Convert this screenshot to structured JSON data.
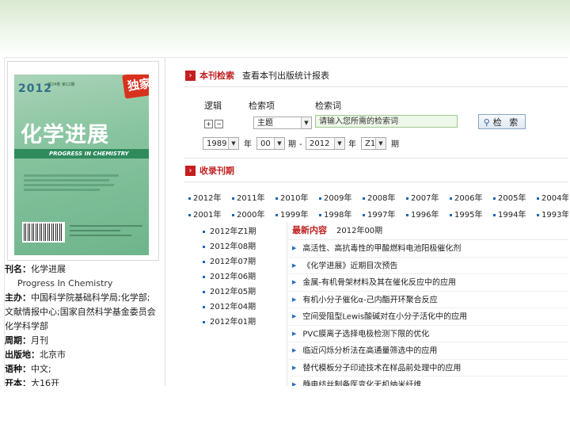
{
  "cover": {
    "year": "2012",
    "issue_text": "第24卷 第12期",
    "badge": "独家",
    "title": "化学进展",
    "title_en": "PROGRESS IN CHEMISTRY"
  },
  "journal_info": [
    {
      "label": "刊名：",
      "value": "化学进展"
    },
    {
      "label": "",
      "value": "Progress In Chemistry",
      "en": true
    },
    {
      "label": "主办：",
      "value": "中国科学院基础科学局;化学部;"
    },
    {
      "label": "",
      "value": "文献情报中心;国家自然科学基金委员会"
    },
    {
      "label": "",
      "value": "化学科学部"
    },
    {
      "label": "周期：",
      "value": "月刊"
    },
    {
      "label": "出版地：",
      "value": "北京市"
    },
    {
      "label": "语种：",
      "value": "中文;"
    },
    {
      "label": "开本：",
      "value": "大16开"
    }
  ],
  "search_section": {
    "title": "本刊检索",
    "link": "查看本刊出版统计报表",
    "col_logic": "逻辑",
    "col_field": "检索项",
    "col_keyword": "检索词",
    "logic_plus": "+",
    "logic_minus": "−",
    "field_value": "主题",
    "keyword_placeholder": "请输入您所需的检索词",
    "search_button": "检 索",
    "year_from": "1989",
    "year_label": "年",
    "issue_from": "00",
    "issue_label": "期",
    "dash": "-",
    "year_to": "2012",
    "year_label2": "年",
    "issue_to": "Z1",
    "issue_label2": "期"
  },
  "collection_section": {
    "title": "收录刊期",
    "years_row1": [
      "2012年",
      "2011年",
      "2010年",
      "2009年",
      "2008年",
      "2007年",
      "2006年",
      "2005年",
      "2004年"
    ],
    "years_row2": [
      "2001年",
      "2000年",
      "1999年",
      "1998年",
      "1997年",
      "1996年",
      "1995年",
      "1994年",
      "1993年"
    ]
  },
  "issues": [
    "2012年Z1期",
    "2012年08期",
    "2012年07期",
    "2012年06期",
    "2012年05期",
    "2012年04期",
    "2012年01期"
  ],
  "latest": {
    "title": "最新内容",
    "issue": "2012年00期",
    "articles": [
      "高活性、高抗毒性的甲酸燃料电池阳极催化剂",
      "《化学进展》近期目次预告",
      "金属-有机骨架材料及其在催化反应中的应用",
      "有机小分子催化α-己内酯开环聚合反应",
      "空间受阻型Lewis酸碱对在小分子活化中的应用",
      "PVC膜离子选择电极检测下限的优化",
      "临近闪烁分析法在高通量筛选中的应用",
      "替代模板分子印迹技术在样品前处理中的应用",
      "静电纺丝制备医变化无机纳米纤维"
    ]
  },
  "icons": {
    "arrow": "section-arrow-icon",
    "search": "search-icon",
    "dot": "bullet-icon"
  },
  "colors": {
    "accent_red": "#c02020",
    "link_blue": "#1a66b6",
    "banner_green": "#d8ead0"
  }
}
